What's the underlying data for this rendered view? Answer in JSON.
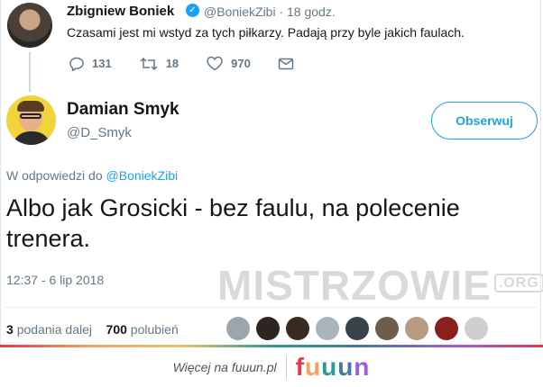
{
  "parent_tweet": {
    "name": "Zbigniew Boniek",
    "handle_time": "@BoniekZibi · 18 godz.",
    "text": "Czasami jest mi wstyd za tych piłkarzy. Padają przy byle jakich faulach.",
    "replies": "131",
    "retweets": "18",
    "likes": "970"
  },
  "reply_tweet": {
    "name": "Damian Smyk",
    "handle": "@D_Smyk",
    "follow_label": "Obserwuj",
    "reply_prefix": "W odpowiedzi do",
    "reply_to_handle": "@BoniekZibi",
    "text": "Albo jak Grosicki - bez faulu, na polecenie trenera.",
    "timestamp": "12:37 - 6 lip 2018",
    "retweet_count": "3",
    "retweet_label": "podania dalej",
    "like_count": "700",
    "like_label": "polubień"
  },
  "watermark": {
    "main": "MISTRZOWIE",
    "suffix": ".ORG"
  },
  "footer": {
    "more_label": "Więcej na fuuun.pl",
    "logo_letters": [
      "f",
      "u",
      "u",
      "u",
      "n"
    ]
  },
  "colors": {
    "accent": "#1da1f2",
    "muted": "#657786",
    "text": "#14171a"
  },
  "likers_colors": [
    "#9aa5ad",
    "#2d2620",
    "#3b2a20",
    "#aab4bb",
    "#39414a",
    "#6e5c4c",
    "#b89a80",
    "#8c1e1e",
    "#cfcfcf"
  ]
}
